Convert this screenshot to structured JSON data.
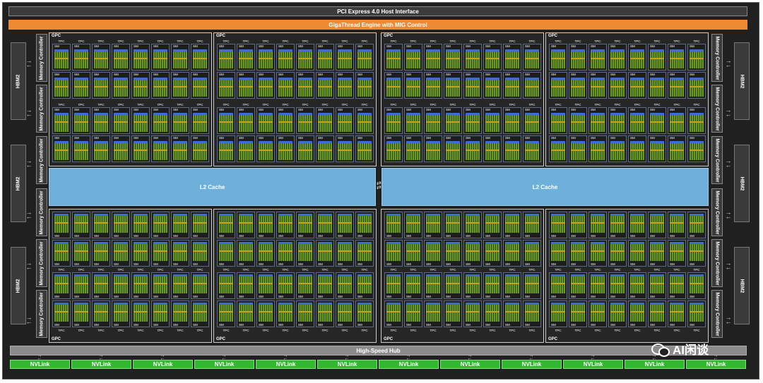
{
  "title_bar": {
    "pcie": "PCI Express 4.0 Host Interface",
    "gigathread": "GigaThread Engine with MIG Control"
  },
  "l2_cache": [
    "L2 Cache",
    "L2 Cache"
  ],
  "hbm_label": "HBM2",
  "memory_controller_label": "Memory Controller",
  "gpc_label": "GPC",
  "tpc_label": "TPC",
  "sm_label": "SM",
  "hub": "High-Speed Hub",
  "nvlinks": [
    "NVLink",
    "NVLink",
    "NVLink",
    "NVLink",
    "NVLink",
    "NVLink",
    "NVLink",
    "NVLink",
    "NVLink",
    "NVLink",
    "NVLink",
    "NVLink"
  ],
  "watermark": "AI闲谈",
  "colors": {
    "gigathread": "#ee8a33",
    "l2": "#6fb0da",
    "nvlink": "#32b830",
    "cores": "#6a9a1e"
  }
}
